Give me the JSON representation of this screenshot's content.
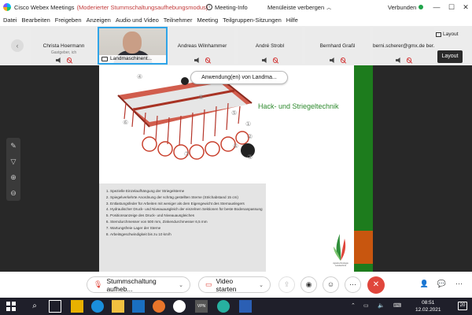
{
  "titlebar": {
    "app_title": "Cisco Webex Meetings",
    "mode": "(Moderierter Stummschaltungsaufhebungsmodus)",
    "meeting_info": "Meeting-Info",
    "hide_menu": "Menüleiste verbergen",
    "status": "Verbunden"
  },
  "menubar": {
    "items": [
      "Datei",
      "Bearbeiten",
      "Freigeben",
      "Anzeigen",
      "Audio und Video",
      "Teilnehmer",
      "Meeting",
      "Teilgruppen-Sitzungen",
      "Hilfe"
    ]
  },
  "participants": [
    {
      "name": "Christa Hoermann",
      "sub": "Gastgeber, ich"
    },
    {
      "name": "Landmaschinent..."
    },
    {
      "name": "Andreas Wilnhammer"
    },
    {
      "name": "André Strobl"
    },
    {
      "name": "Bernhard Graßl"
    },
    {
      "name": "berni.scherer@gmx.de ber..."
    }
  ],
  "layout": {
    "label": "Layout",
    "tooltip": "Layout"
  },
  "slide": {
    "share_tag": "Anwendung(en) von Landma...",
    "title": "Hack- und Striegeltechnik",
    "bullets": [
      "Spezielle Einzelaufhängung der Striegelsterne",
      "Spiegelverkehrte Anordnung der schräg gestellten Sterne (Strichabstand 15 cm)",
      "Entlastungsfeder für Arbeiten mit weniger als dem Eigengewicht des Sternauslegers",
      "Hydraulischer Druck- und Niveauausgleich der einzelnen Sektionen für beste Bodenanpassung",
      "Positionsanzeige des Druck- und Niveauausgleiches",
      "Sterndurchmesser von 500 mm, Zinkendurchmesser 6,5 mm",
      "Wartungsfreie Lager der Sterne",
      "Arbeitsgeschwindigkeit bis zu 10 km/h"
    ],
    "callouts": [
      "④",
      "⑥",
      "⑦",
      "⑧",
      "⑤",
      "①",
      "②",
      "③",
      "⑤"
    ],
    "logo_text": "Agrartechnologie Landtechnik"
  },
  "controls": {
    "mute": "Stummschaltung aufheb...",
    "video": "Video starten"
  },
  "taskbar": {
    "time": "08:51",
    "date": "12.02.2021",
    "notifications": "20"
  },
  "colors": {
    "accent": "#2ea4e8",
    "end": "#e0463c",
    "slide_title": "#2e8a2e",
    "green_bar": "#1d7c1d",
    "orange_bar": "#c8560f"
  }
}
